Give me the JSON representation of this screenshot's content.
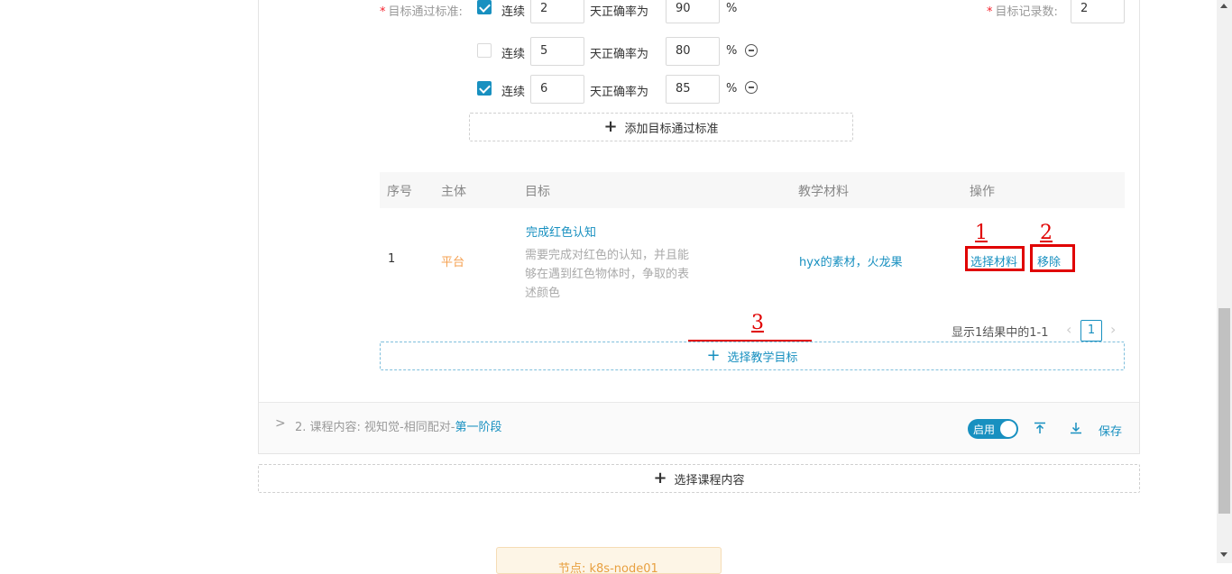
{
  "criteria": {
    "required_mark": "*",
    "label": "目标通过标准:",
    "record_label": "目标记录数:",
    "record_value": "2",
    "rows": [
      {
        "checked": true,
        "consecutive_label": "连续",
        "count": "2",
        "accuracy_label": "天正确率为",
        "rate": "90",
        "unit": "%",
        "removable": false
      },
      {
        "checked": false,
        "consecutive_label": "连续",
        "count": "5",
        "accuracy_label": "天正确率为",
        "rate": "80",
        "unit": "%",
        "removable": true
      },
      {
        "checked": true,
        "consecutive_label": "连续",
        "count": "6",
        "accuracy_label": "天正确率为",
        "rate": "85",
        "unit": "%",
        "removable": true
      }
    ],
    "add_label": "添加目标通过标准"
  },
  "table": {
    "headers": [
      "序号",
      "主体",
      "目标",
      "教学材料",
      "操作"
    ],
    "rows": [
      {
        "index": "1",
        "subject": "平台",
        "goal_title": "完成红色认知",
        "goal_desc_lines": [
          "需要完成对红色的认知，并且能",
          "够在遇到红色物体时，争取的表",
          "述颜色"
        ],
        "materials": "hyx的素材，火龙果",
        "action_select": "选择材料",
        "action_remove": "移除"
      }
    ],
    "pagination_text": "显示1结果中的1-1",
    "current_page": "1",
    "select_goal_label": "选择教学目标"
  },
  "annotations": [
    "1",
    "2",
    "3"
  ],
  "course": {
    "chevron": ">",
    "title_prefix": "2. 课程内容: 视知觉-相同配对-",
    "title_link": "第一阶段",
    "toggle_label": "启用",
    "save_label": "保存"
  },
  "select_course_label": "选择课程内容",
  "footer_note": "节点: k8s-node01"
}
